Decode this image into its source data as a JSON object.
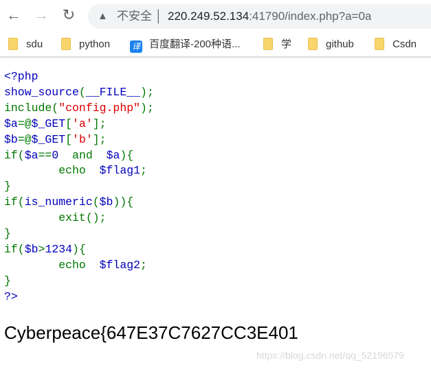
{
  "browser": {
    "back_icon": "arrow-left",
    "forward_icon": "arrow-right",
    "reload_icon": "reload",
    "security_label": "不安全",
    "url_host": "220.249.52.134",
    "url_rest": ":41790/index.php?a=0a",
    "bookmarks": [
      {
        "label": "sdu",
        "icon": "folder"
      },
      {
        "label": "python",
        "icon": "folder"
      },
      {
        "label": "百度翻译-200种语...",
        "icon": "baidu-translate",
        "icon_text": "译"
      },
      {
        "label": "学",
        "icon": "folder"
      },
      {
        "label": "github",
        "icon": "folder"
      },
      {
        "label": "Csdn",
        "icon": "folder"
      }
    ]
  },
  "colors": {
    "default": "#0000BB",
    "keyword": "#007700",
    "string": "#DD0000"
  },
  "code": [
    [
      [
        "<?php",
        "b"
      ]
    ],
    [
      [
        "show_source",
        "b"
      ],
      [
        "(",
        "g"
      ],
      [
        "__FILE__",
        "b"
      ],
      [
        ");",
        "g"
      ]
    ],
    [
      [
        "include(",
        "g"
      ],
      [
        "\"config.php\"",
        "r"
      ],
      [
        ");",
        "g"
      ]
    ],
    [
      [
        "$a",
        "b"
      ],
      [
        "=@",
        "g"
      ],
      [
        "$_GET",
        "b"
      ],
      [
        "[",
        "g"
      ],
      [
        "'a'",
        "r"
      ],
      [
        "];",
        "g"
      ]
    ],
    [
      [
        "$b",
        "b"
      ],
      [
        "=@",
        "g"
      ],
      [
        "$_GET",
        "b"
      ],
      [
        "[",
        "g"
      ],
      [
        "'b'",
        "r"
      ],
      [
        "];",
        "g"
      ]
    ],
    [
      [
        "if(",
        "g"
      ],
      [
        "$a",
        "b"
      ],
      [
        "==",
        "g"
      ],
      [
        "0",
        "b"
      ],
      [
        "  and  ",
        "g"
      ],
      [
        "$a",
        "b"
      ],
      [
        "){",
        "g"
      ]
    ],
    [
      [
        "        echo  ",
        "g"
      ],
      [
        "$flag1",
        "b"
      ],
      [
        ";",
        "g"
      ]
    ],
    [
      [
        "}",
        "g"
      ]
    ],
    [
      [
        "if(",
        "g"
      ],
      [
        "is_numeric",
        "b"
      ],
      [
        "(",
        "g"
      ],
      [
        "$b",
        "b"
      ],
      [
        ")){",
        "g"
      ]
    ],
    [
      [
        "        exit();",
        "g"
      ]
    ],
    [
      [
        "}",
        "g"
      ]
    ],
    [
      [
        "if(",
        "g"
      ],
      [
        "$b",
        "b"
      ],
      [
        ">",
        "g"
      ],
      [
        "1234",
        "b"
      ],
      [
        "){",
        "g"
      ]
    ],
    [
      [
        "        echo  ",
        "g"
      ],
      [
        "$flag2",
        "b"
      ],
      [
        ";",
        "g"
      ]
    ],
    [
      [
        "}",
        "g"
      ]
    ],
    [
      [
        "?>",
        "b"
      ]
    ]
  ],
  "output": "Cyberpeace{647E37C7627CC3E401",
  "watermark": "https://blog.csdn.net/qq_52196579"
}
